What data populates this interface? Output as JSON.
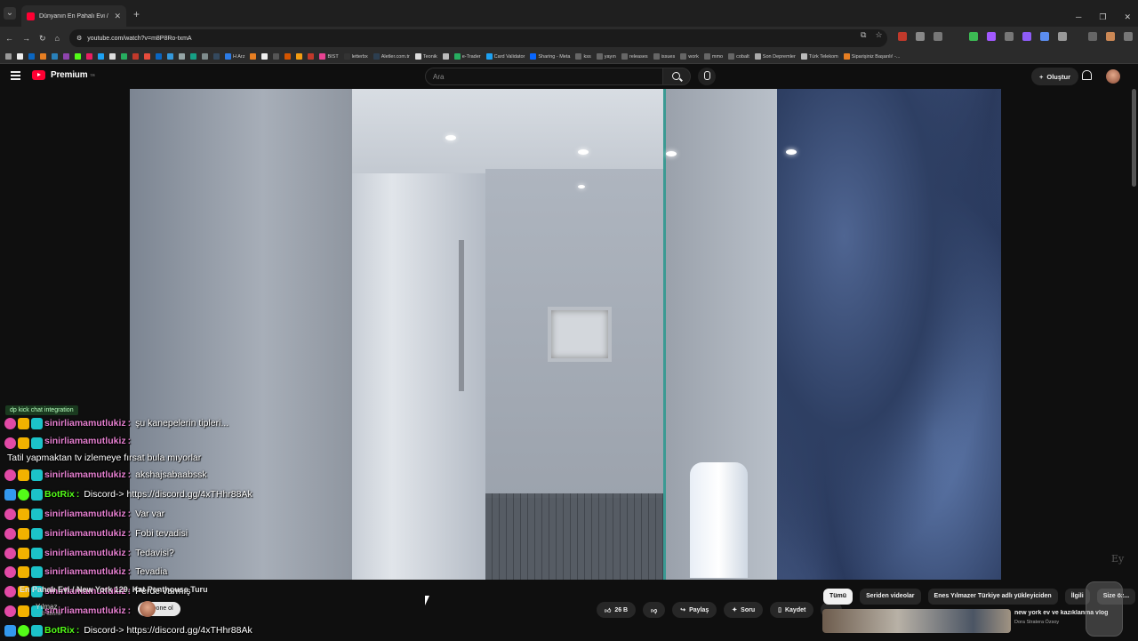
{
  "browser": {
    "tab_title": "Dünyanın En Pahalı Evi / New Y",
    "url": "youtube.com/watch?v=m8P8Ro-txmA",
    "bookmarks": [
      "H Arz",
      "BIST",
      "letterbx",
      "Aletler.com.tr",
      "Teonik",
      "e-Trader",
      "Card Validator",
      "Sharing - Meta",
      "kss",
      "yayın",
      "releases",
      "issues",
      "work",
      "mmo",
      "cobalt",
      "Son Depremler",
      "Türk Telekom",
      "Siparişiniz Başarılı! -..."
    ]
  },
  "youtube": {
    "logo_text": "Premium",
    "logo_badge": "TR",
    "search_placeholder": "Ara",
    "create_label": "Oluştur"
  },
  "chat": {
    "title": "dp kick chat integration",
    "messages": [
      {
        "user": "sinirliamamutlukiz",
        "text": "şu kanepelerin tipleri...",
        "bot": false
      },
      {
        "user": "sinirliamamutlukiz",
        "text": "Tatil yapmaktan tv izlemeye fırsat bula mıyorlar",
        "bot": false
      },
      {
        "user": "sinirliamamutlukiz",
        "text": "akshajsabaabssk",
        "bot": false
      },
      {
        "user": "BotRix",
        "text": "Discord-> https://discord.gg/4xTHhr88Ak",
        "bot": true
      },
      {
        "user": "sinirliamamutlukiz",
        "text": "Var var",
        "bot": false
      },
      {
        "user": "sinirliamamutlukiz",
        "text": "Fobi tevadisi",
        "bot": false
      },
      {
        "user": "sinirliamamutlukiz",
        "text": "Tedavisi?",
        "bot": false
      },
      {
        "user": "sinirliamamutlukiz",
        "text": "Tevadia",
        "bot": false
      },
      {
        "user": "sinirliamamutlukiz",
        "text": "Perde varmış",
        "bot": false
      },
      {
        "user": "sinirliamamutlukiz",
        "text": "",
        "bot": false
      },
      {
        "user": "BotRix",
        "text": "Discord-> https://discord.gg/4xTHhr88Ak",
        "bot": true
      }
    ]
  },
  "video": {
    "title": "En Pahalı Evi / New York 129. Kat Penthouse Turu",
    "channel": "Yılmaz",
    "subs": "... B abone",
    "subscribe_label": "Abone ol",
    "watermark": "Ey"
  },
  "actions": {
    "likes": "26 B",
    "share": "Paylaş",
    "ask": "Soru",
    "save": "Kaydet",
    "more": "..."
  },
  "chips": [
    "Tümü",
    "Seriden videolar",
    "Enes Yılmazer Türkiye adlı yükleyiciden",
    "İlgili",
    "Size öz..."
  ],
  "recommended": {
    "title": "new york ev ve kazıklanma vlog",
    "channel": "Dora Stratera Özsoy"
  }
}
